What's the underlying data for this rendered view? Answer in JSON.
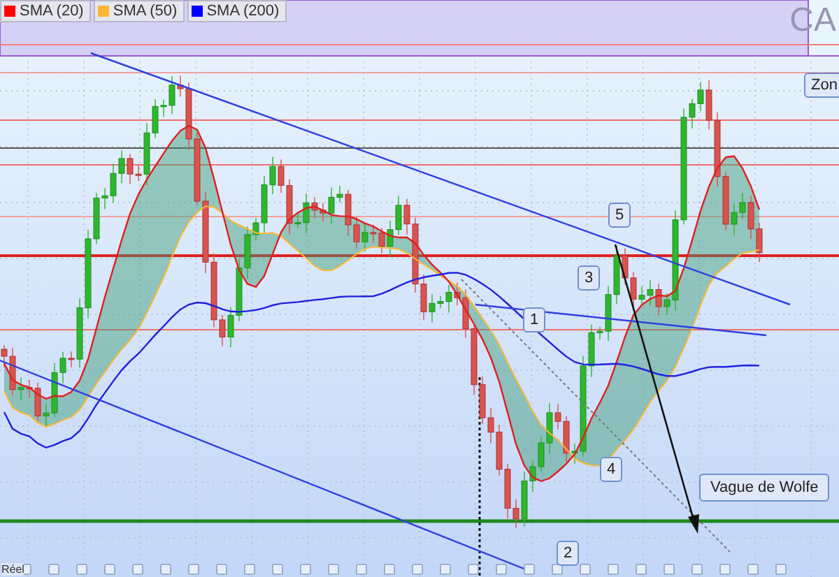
{
  "legend": [
    {
      "label": "SMA (20)",
      "color": "#ff0000"
    },
    {
      "label": "SMA (50)",
      "color": "#ffb833"
    },
    {
      "label": "SMA (200)",
      "color": "#0000ff"
    }
  ],
  "chart_symbol": "CA",
  "zone_label": "Zon",
  "wave_labels": [
    "1",
    "2",
    "3",
    "4",
    "5"
  ],
  "pattern_label": "Vague de Wolfe",
  "bottom_label": "Réel"
}
